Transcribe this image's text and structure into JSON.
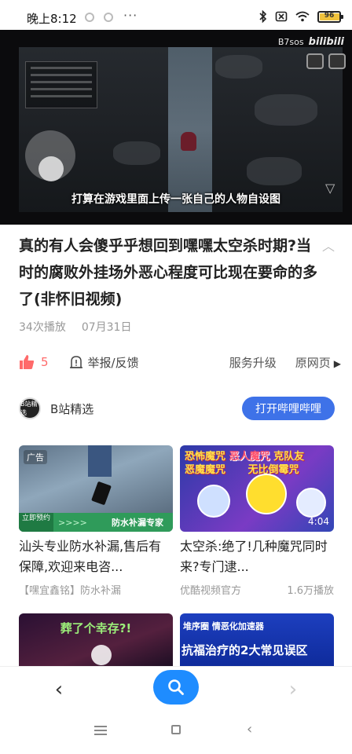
{
  "status_bar": {
    "time": "晚上8:12",
    "dots": "···",
    "battery": "96",
    "battery_level": 0.96
  },
  "video": {
    "watermark": "B7sos",
    "brand": "bilibili",
    "subtitle": "打算在游戏里面上传一张自己的人物自设图"
  },
  "article": {
    "title": "真的有人会傻乎乎想回到嘿嘿太空杀时期?当时的腐败外挂场外恶心程度可比现在要命的多了(非怀旧视频)",
    "views": "34次播放",
    "date": "07月31日"
  },
  "actions": {
    "like_count": "5",
    "report": "举报/反馈",
    "service_upgrade": "服务升级",
    "original_page": "原网页"
  },
  "source": {
    "avatar_text": "B站精选",
    "name": "B站精选",
    "open_button": "打开哔哩哔哩"
  },
  "cards": [
    {
      "ad_label": "广告",
      "tag": "立即预约",
      "banner": "防水补漏专家",
      "arrows": ">>>>",
      "title": "汕头专业防水补漏,售后有保障,欢迎来电咨...",
      "source": "【嘿宜鑫铭】防水补漏",
      "extra": ""
    },
    {
      "banner_left": "恐怖魔咒",
      "banner_mid": "恶人魔咒",
      "banner_right": "克队友",
      "banner_left2": "恶魔魔咒",
      "banner_right2": "无比倒霉咒",
      "duration": "4:04",
      "title": "太空杀:绝了!几种魔咒同时来?专门逮...",
      "source": "优酷视频官方",
      "extra": "1.6万播放"
    },
    {
      "label": "葬了个幸存?!"
    },
    {
      "label_top": "堆序圈 情恶化加速器",
      "label_main": "抗福治疗的2大常见误区"
    }
  ],
  "nav": {
    "back": "‹",
    "forward": "›"
  },
  "icons": [
    "thumb-up-icon",
    "report-icon",
    "search-icon",
    "chevron-up-icon",
    "play-arrow-icon"
  ]
}
